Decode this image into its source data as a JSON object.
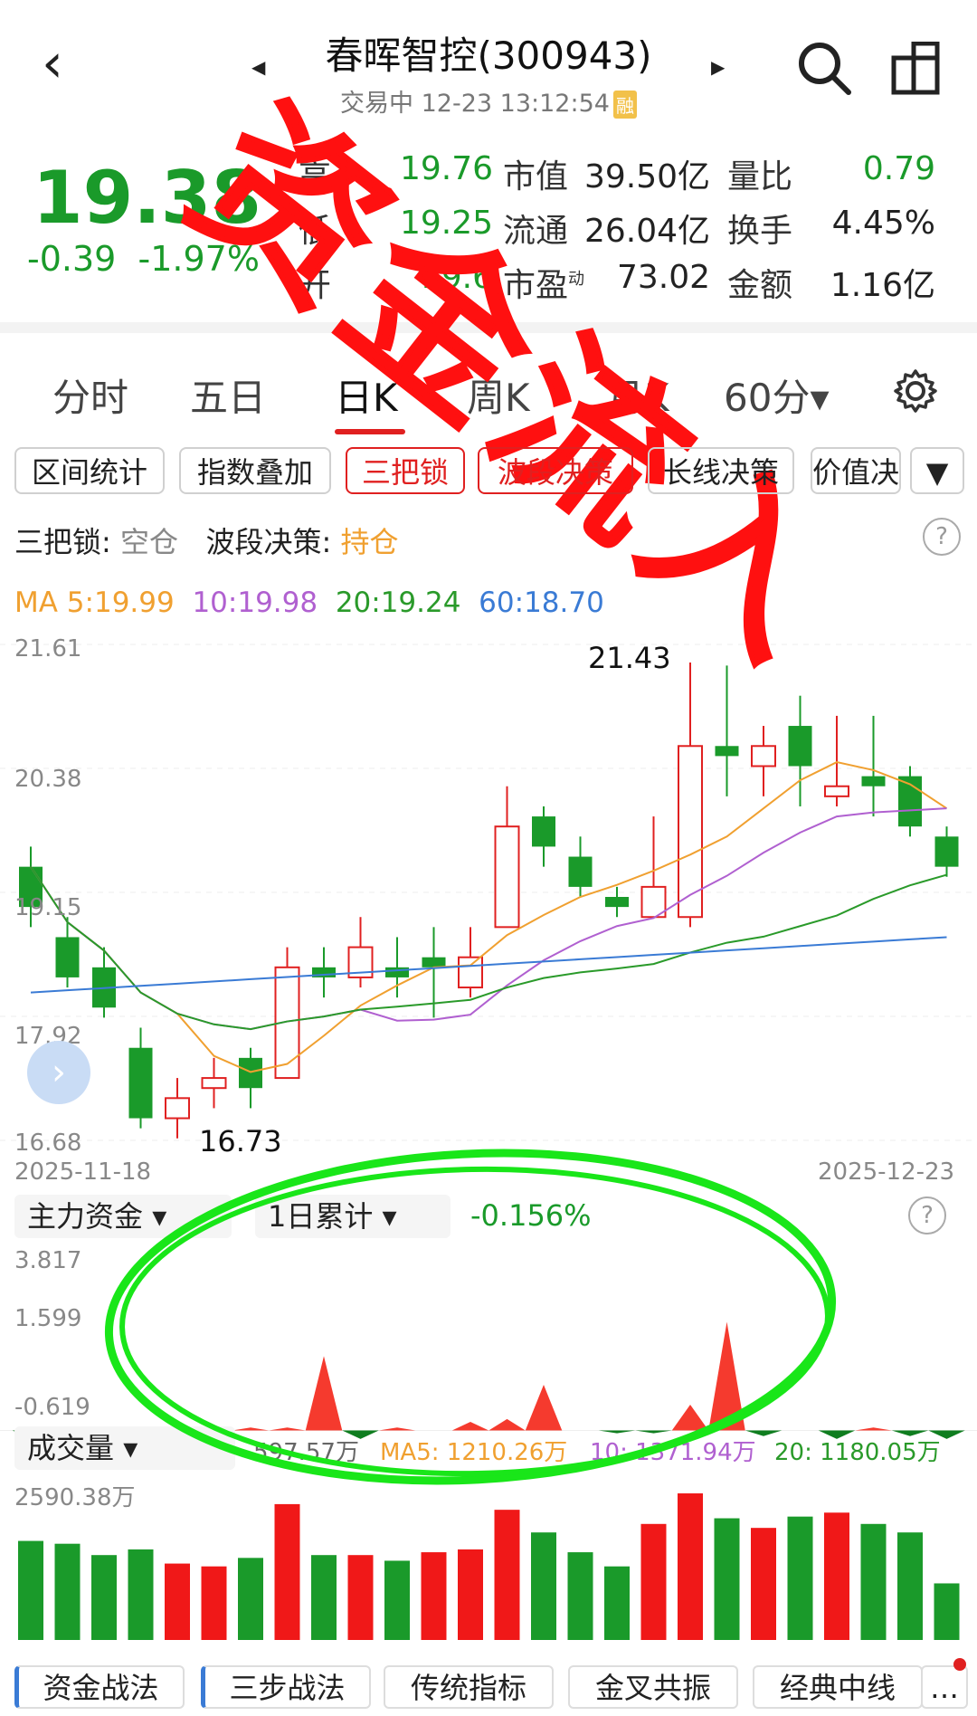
{
  "header": {
    "title": "春晖智控(300943)",
    "subtitle": "交易中 12-23 13:12:54",
    "badge": "融"
  },
  "quote": {
    "price": "19.38",
    "change": "-0.39",
    "change_pct": "-1.97%",
    "rows": [
      {
        "l1": "高",
        "v1": "19.76",
        "l2": "市值",
        "v2": "39.50亿",
        "l3": "量比",
        "v3": "0.79"
      },
      {
        "l1": "低",
        "v1": "19.25",
        "l2": "流通",
        "v2": "26.04亿",
        "l3": "换手",
        "v3": "4.45%"
      },
      {
        "l1": "开",
        "v1": "19.6",
        "l2": "市盈",
        "sup": "动",
        "v2": "73.02",
        "l3": "金额",
        "v3": "1.16亿"
      }
    ]
  },
  "tabs": [
    "分时",
    "五日",
    "日K",
    "周K",
    "月K",
    "60分"
  ],
  "chips": [
    "区间统计",
    "指数叠加",
    "三把锁",
    "波段决策",
    "长线决策",
    "价值决"
  ],
  "lock_status": {
    "label1": "三把锁:",
    "value1": "空仓",
    "label2": "波段决策:",
    "value2": "持仓"
  },
  "ma_legend": {
    "ma5": "MA 5:19.99",
    "ma10": "10:19.98",
    "ma20": "20:19.24",
    "ma60": "60:18.70"
  },
  "kline_axis": {
    "y_top": "21.61",
    "y2": "20.38",
    "y3": "19.15",
    "y4": "17.92",
    "y_bottom": "16.68",
    "date_start": "2025-11-18",
    "date_end": "2025-12-23",
    "high_label": "21.43",
    "low_label": "16.73"
  },
  "fund": {
    "selector1": "主力资金",
    "selector2": "1日累计",
    "value": "-0.156%",
    "y_top": "3.817",
    "y_mid": "1.599",
    "y_bottom": "-0.619"
  },
  "volume": {
    "selector": "成交量",
    "value": "597.57万",
    "ma5": "MA5: 1210.26万",
    "ma10": "10: 1371.94万",
    "ma20": "20: 1180.05万",
    "y_top": "2590.38万"
  },
  "bottom_tabs": [
    "资金战法",
    "三步战法",
    "传统指标",
    "金叉共振",
    "经典中线"
  ],
  "annotation": {
    "text": "资金流入"
  },
  "chart_data": {
    "type": "candlestick",
    "candles": [
      {
        "o": 19.0,
        "c": 19.4,
        "h": 19.6,
        "l": 18.8,
        "up": false
      },
      {
        "o": 18.7,
        "c": 18.3,
        "h": 18.9,
        "l": 18.2,
        "up": false
      },
      {
        "o": 18.4,
        "c": 18.0,
        "h": 18.6,
        "l": 17.9,
        "up": false
      },
      {
        "o": 17.6,
        "c": 16.9,
        "h": 17.8,
        "l": 16.8,
        "up": false
      },
      {
        "o": 16.9,
        "c": 17.1,
        "h": 17.3,
        "l": 16.7,
        "up": true
      },
      {
        "o": 17.2,
        "c": 17.3,
        "h": 17.5,
        "l": 17.0,
        "up": true
      },
      {
        "o": 17.2,
        "c": 17.5,
        "h": 17.6,
        "l": 17.0,
        "up": false
      },
      {
        "o": 17.3,
        "c": 18.4,
        "h": 18.6,
        "l": 17.3,
        "up": true
      },
      {
        "o": 18.4,
        "c": 18.3,
        "h": 18.6,
        "l": 18.1,
        "up": false
      },
      {
        "o": 18.3,
        "c": 18.6,
        "h": 18.9,
        "l": 18.2,
        "up": true
      },
      {
        "o": 18.4,
        "c": 18.3,
        "h": 18.7,
        "l": 18.1,
        "up": false
      },
      {
        "o": 18.5,
        "c": 18.4,
        "h": 18.8,
        "l": 17.9,
        "up": false
      },
      {
        "o": 18.2,
        "c": 18.5,
        "h": 18.8,
        "l": 18.1,
        "up": true
      },
      {
        "o": 18.8,
        "c": 19.8,
        "h": 20.2,
        "l": 18.8,
        "up": true
      },
      {
        "o": 19.9,
        "c": 19.6,
        "h": 20.0,
        "l": 19.4,
        "up": false
      },
      {
        "o": 19.5,
        "c": 19.2,
        "h": 19.7,
        "l": 19.1,
        "up": false
      },
      {
        "o": 19.1,
        "c": 19.0,
        "h": 19.2,
        "l": 18.9,
        "up": false
      },
      {
        "o": 18.9,
        "c": 19.2,
        "h": 19.9,
        "l": 18.9,
        "up": true
      },
      {
        "o": 18.9,
        "c": 20.6,
        "h": 21.43,
        "l": 18.8,
        "up": true
      },
      {
        "o": 20.6,
        "c": 20.5,
        "h": 21.4,
        "l": 20.1,
        "up": false
      },
      {
        "o": 20.4,
        "c": 20.6,
        "h": 20.8,
        "l": 20.1,
        "up": true
      },
      {
        "o": 20.8,
        "c": 20.4,
        "h": 21.1,
        "l": 20.0,
        "up": false
      },
      {
        "o": 20.2,
        "c": 20.1,
        "h": 20.9,
        "l": 20.0,
        "up": true
      },
      {
        "o": 20.3,
        "c": 20.2,
        "h": 20.9,
        "l": 19.9,
        "up": false
      },
      {
        "o": 20.3,
        "c": 19.8,
        "h": 20.4,
        "l": 19.7,
        "up": false
      },
      {
        "o": 19.7,
        "c": 19.4,
        "h": 19.8,
        "l": 19.3,
        "up": false
      }
    ],
    "fund_series": [
      -0.3,
      -0.4,
      -0.3,
      -0.2,
      -0.1,
      0.0,
      0.1,
      0.1,
      2.6,
      -0.3,
      0.1,
      0.0,
      0.3,
      0.4,
      1.6,
      0.0,
      -0.1,
      -0.1,
      0.9,
      3.8,
      -0.2,
      0.0,
      -0.3,
      0.1,
      -0.2,
      -0.3
    ],
    "volumes": [
      1750,
      1700,
      1500,
      1600,
      1350,
      1300,
      1450,
      2400,
      1500,
      1500,
      1400,
      1550,
      1600,
      2300,
      1900,
      1550,
      1300,
      2050,
      2590,
      2150,
      1980,
      2180,
      2250,
      2050,
      1900,
      1000
    ],
    "volume_up": [
      false,
      false,
      false,
      false,
      true,
      true,
      false,
      true,
      false,
      true,
      false,
      true,
      true,
      true,
      false,
      false,
      false,
      true,
      true,
      false,
      true,
      false,
      true,
      false,
      false,
      false
    ],
    "ylim": [
      16.68,
      21.61
    ]
  }
}
